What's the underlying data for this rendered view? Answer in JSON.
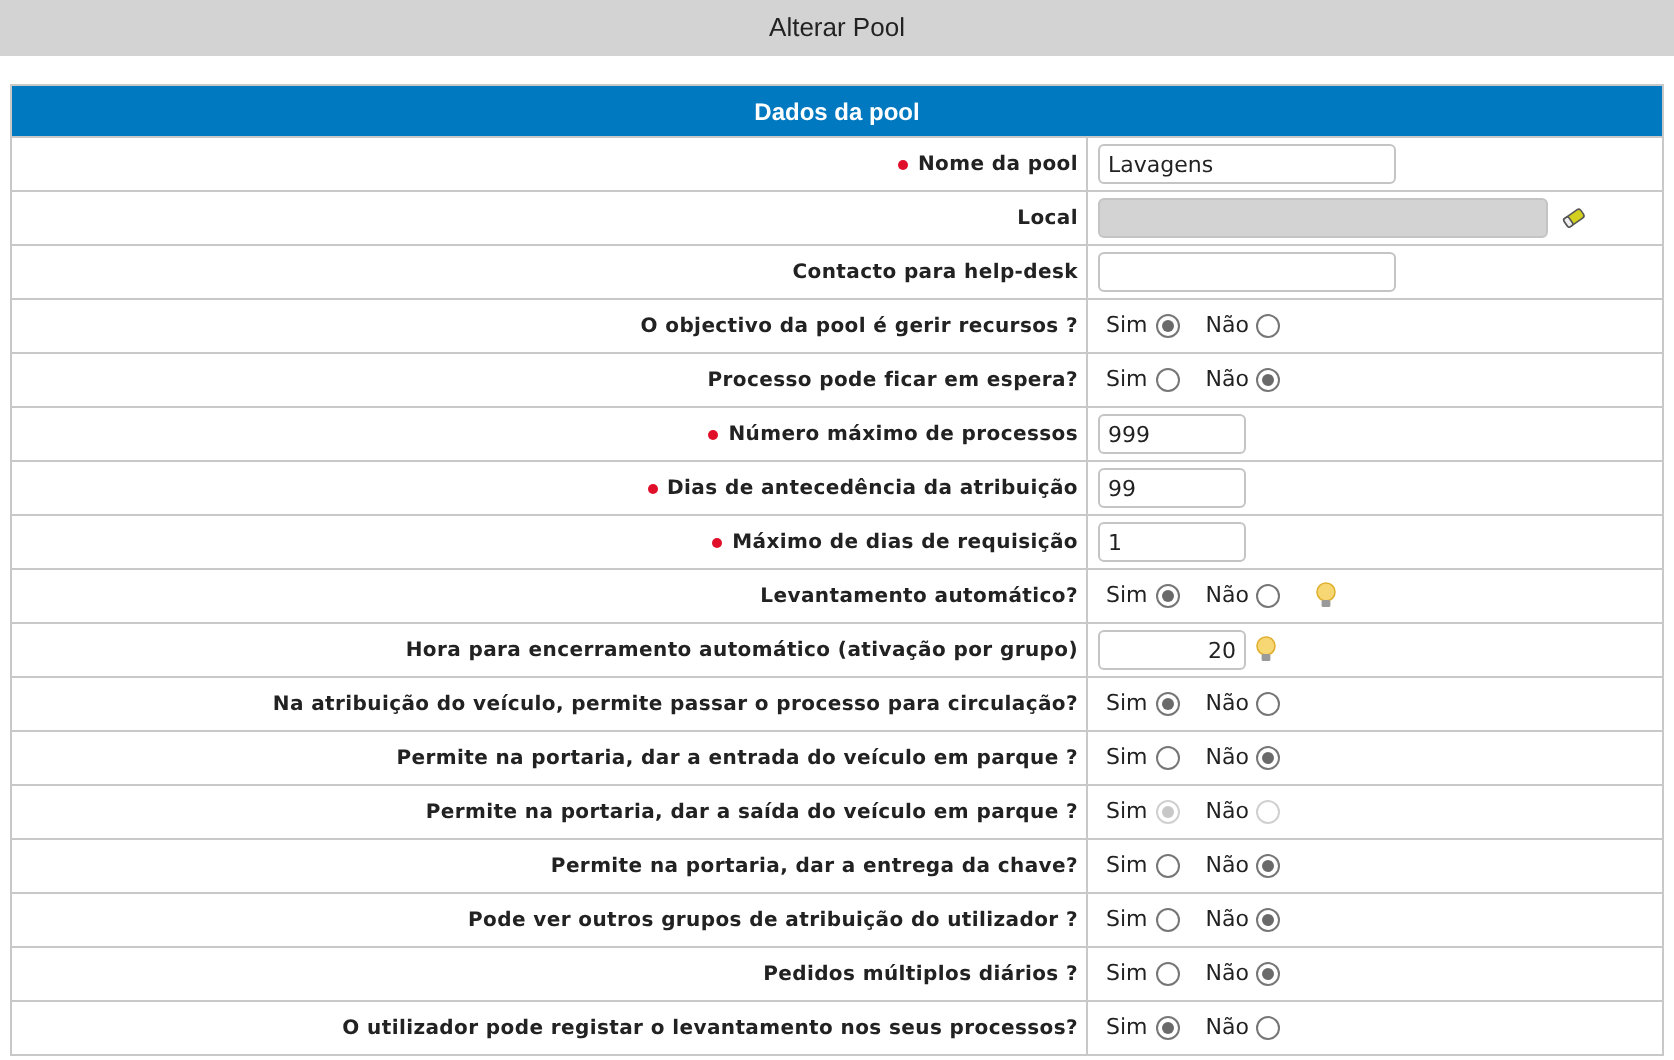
{
  "page_title": "Alterar Pool",
  "section": {
    "title": "Dados da pool"
  },
  "rows": [
    {
      "label": "Nome da pool",
      "required": true,
      "kind": "text",
      "value": "Lavagens",
      "tip": false
    },
    {
      "label": "Local",
      "required": false,
      "kind": "lookup",
      "value": "",
      "tip": false
    },
    {
      "label": "Contacto para help-desk",
      "required": false,
      "kind": "text",
      "value": "",
      "tip": false
    },
    {
      "label": "O objectivo da pool é gerir recursos ?",
      "required": false,
      "kind": "radio",
      "disabled": false,
      "tip": false,
      "options": [
        {
          "label": "Sim",
          "selected": true
        },
        {
          "label": "Não",
          "selected": false
        }
      ]
    },
    {
      "label": "Processo pode ficar em espera?",
      "required": false,
      "kind": "radio",
      "disabled": false,
      "tip": false,
      "options": [
        {
          "label": "Sim",
          "selected": false
        },
        {
          "label": "Não",
          "selected": true
        }
      ]
    },
    {
      "label": "Número máximo de processos",
      "required": true,
      "kind": "number",
      "value": "999",
      "tip": false
    },
    {
      "label": "Dias de antecedência da atribuição",
      "required": true,
      "kind": "number",
      "value": "99",
      "tip": false
    },
    {
      "label": "Máximo de dias de requisição",
      "required": true,
      "kind": "number",
      "value": "1",
      "tip": false
    },
    {
      "label": "Levantamento automático?",
      "required": false,
      "kind": "radio",
      "disabled": false,
      "tip": true,
      "options": [
        {
          "label": "Sim",
          "selected": true
        },
        {
          "label": "Não",
          "selected": false
        }
      ]
    },
    {
      "label": "Hora para encerramento automático (ativação por grupo)",
      "required": false,
      "kind": "time",
      "value": "20",
      "tip": true
    },
    {
      "label": "Na atribuição do veículo, permite passar o processo para circulação?",
      "required": false,
      "kind": "radio",
      "disabled": false,
      "tip": false,
      "options": [
        {
          "label": "Sim",
          "selected": true
        },
        {
          "label": "Não",
          "selected": false
        }
      ]
    },
    {
      "label": "Permite na portaria, dar a entrada do veículo em parque ?",
      "required": false,
      "kind": "radio",
      "disabled": false,
      "tip": false,
      "options": [
        {
          "label": "Sim",
          "selected": false
        },
        {
          "label": "Não",
          "selected": true
        }
      ]
    },
    {
      "label": "Permite na portaria, dar a saída do veículo em parque ?",
      "required": false,
      "kind": "radio",
      "disabled": true,
      "tip": false,
      "options": [
        {
          "label": "Sim",
          "selected": true
        },
        {
          "label": "Não",
          "selected": false
        }
      ]
    },
    {
      "label": "Permite na portaria, dar a entrega da chave?",
      "required": false,
      "kind": "radio",
      "disabled": false,
      "tip": false,
      "options": [
        {
          "label": "Sim",
          "selected": false
        },
        {
          "label": "Não",
          "selected": true
        }
      ]
    },
    {
      "label": "Pode ver outros grupos de atribuição do utilizador ?",
      "required": false,
      "kind": "radio",
      "disabled": false,
      "tip": false,
      "options": [
        {
          "label": "Sim",
          "selected": false
        },
        {
          "label": "Não",
          "selected": true
        }
      ]
    },
    {
      "label": "Pedidos múltiplos diários ?",
      "required": false,
      "kind": "radio",
      "disabled": false,
      "tip": false,
      "options": [
        {
          "label": "Sim",
          "selected": false
        },
        {
          "label": "Não",
          "selected": true
        }
      ]
    },
    {
      "label": "O utilizador pode registar o levantamento nos seus processos?",
      "required": false,
      "kind": "radio",
      "disabled": false,
      "tip": false,
      "options": [
        {
          "label": "Sim",
          "selected": true
        },
        {
          "label": "Não",
          "selected": false
        }
      ]
    }
  ]
}
